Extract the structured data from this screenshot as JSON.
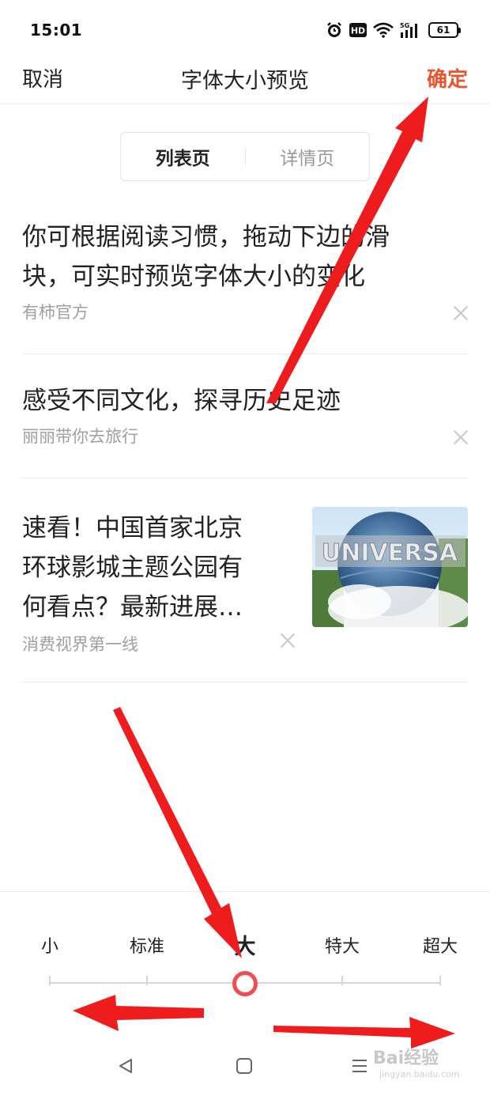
{
  "status_bar": {
    "time": "15:01",
    "icons": [
      "alarm-icon",
      "hd-icon",
      "wifi-icon",
      "5g-signal-icon"
    ],
    "battery": "61"
  },
  "header": {
    "cancel": "取消",
    "title": "字体大小预览",
    "confirm": "确定",
    "confirm_color": "#e8542e"
  },
  "tabs": [
    {
      "label": "列表页",
      "active": true
    },
    {
      "label": "详情页",
      "active": false
    }
  ],
  "feed": [
    {
      "title_line1": "你可根据阅读习惯，拖动下边的滑",
      "title_line2": "块，可实时预览字体大小的变化",
      "source": "有柿官方"
    },
    {
      "title_line1": "感受不同文化，探寻历史足迹",
      "source": "丽丽带你去旅行"
    },
    {
      "title_line1": "速看！中国首家北京",
      "title_line2": "环球影城主题公园有",
      "title_line3": "何看点？最新进展…",
      "source": "消费视界第一线",
      "thumbnail_text": "UNIVERSA"
    }
  ],
  "font_size": {
    "options": [
      "小",
      "标准",
      "大",
      "特大",
      "超大"
    ],
    "selected_index": 2,
    "accent_color": "#ee4e52"
  },
  "nav_bar": {
    "buttons": [
      "back-icon",
      "home-icon",
      "menu-icon"
    ]
  },
  "watermark": {
    "text": "Bai经验",
    "sub": "jingyan.baidu.com"
  }
}
